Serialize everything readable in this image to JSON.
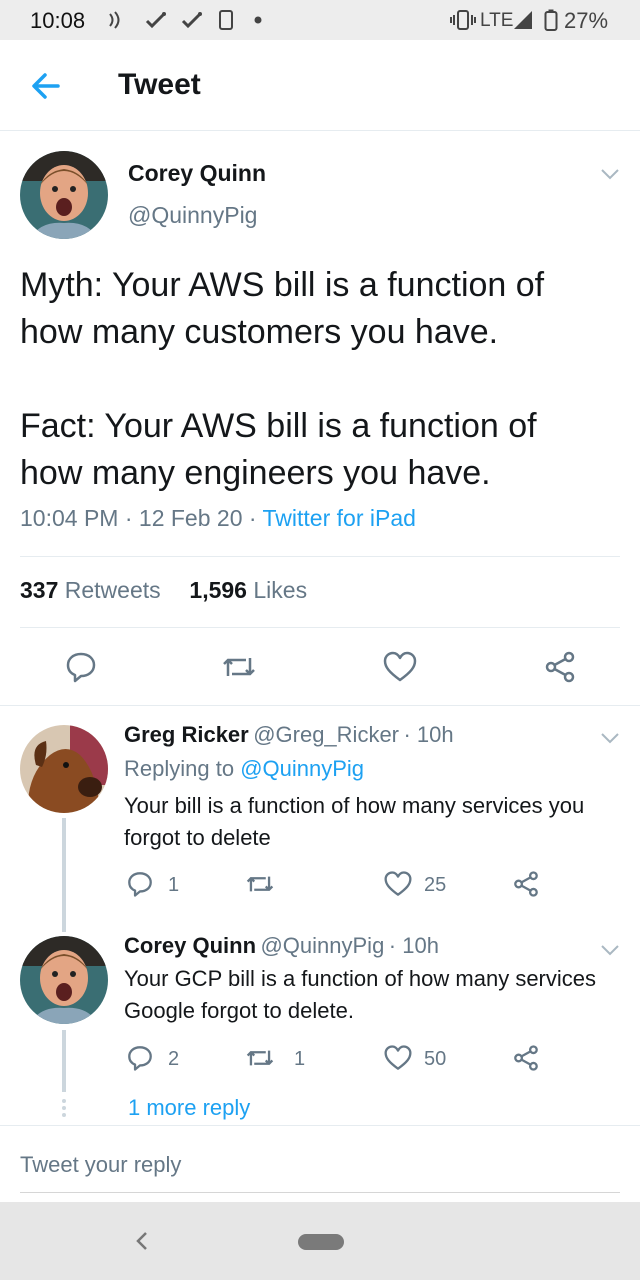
{
  "status_bar": {
    "time": "10:08",
    "network": "LTE",
    "battery": "27%"
  },
  "header": {
    "title": "Tweet",
    "back_icon": "arrow-left-icon"
  },
  "main_tweet": {
    "author_name": "Corey Quinn",
    "author_handle": "@QuinnyPig",
    "text": "Myth: Your AWS bill is a function of\nhow many customers you have.\n\nFact: Your AWS bill is a function of\nhow many engineers you have.",
    "time": "10:04 PM",
    "date": "12 Feb 20",
    "source": "Twitter for iPad",
    "retweets_count": "337",
    "retweets_label": "Retweets",
    "likes_count": "1,596",
    "likes_label": "Likes",
    "actions": [
      "reply-icon",
      "retweet-icon",
      "like-icon",
      "share-icon"
    ]
  },
  "replies": [
    {
      "author_name": "Greg Ricker",
      "author_handle": "@Greg_Ricker",
      "age": "10h",
      "replying_to_label": "Replying to",
      "replying_to_handle": "@QuinnyPig",
      "text": "Your bill is a function of how many services you forgot to delete",
      "reply_count": "1",
      "retweet_count": "",
      "like_count": "25"
    },
    {
      "author_name": "Corey Quinn",
      "author_handle": "@QuinnyPig",
      "age": "10h",
      "text": "Your GCP bill is a function of how many services Google forgot to delete.",
      "reply_count": "2",
      "retweet_count": "1",
      "like_count": "50"
    }
  ],
  "more_replies": "1 more reply",
  "compose": {
    "placeholder": "Tweet your reply"
  },
  "colors": {
    "accent": "#1da1f2",
    "text_primary": "#14171a",
    "text_secondary": "#657786",
    "divider": "#e6ecf0"
  }
}
